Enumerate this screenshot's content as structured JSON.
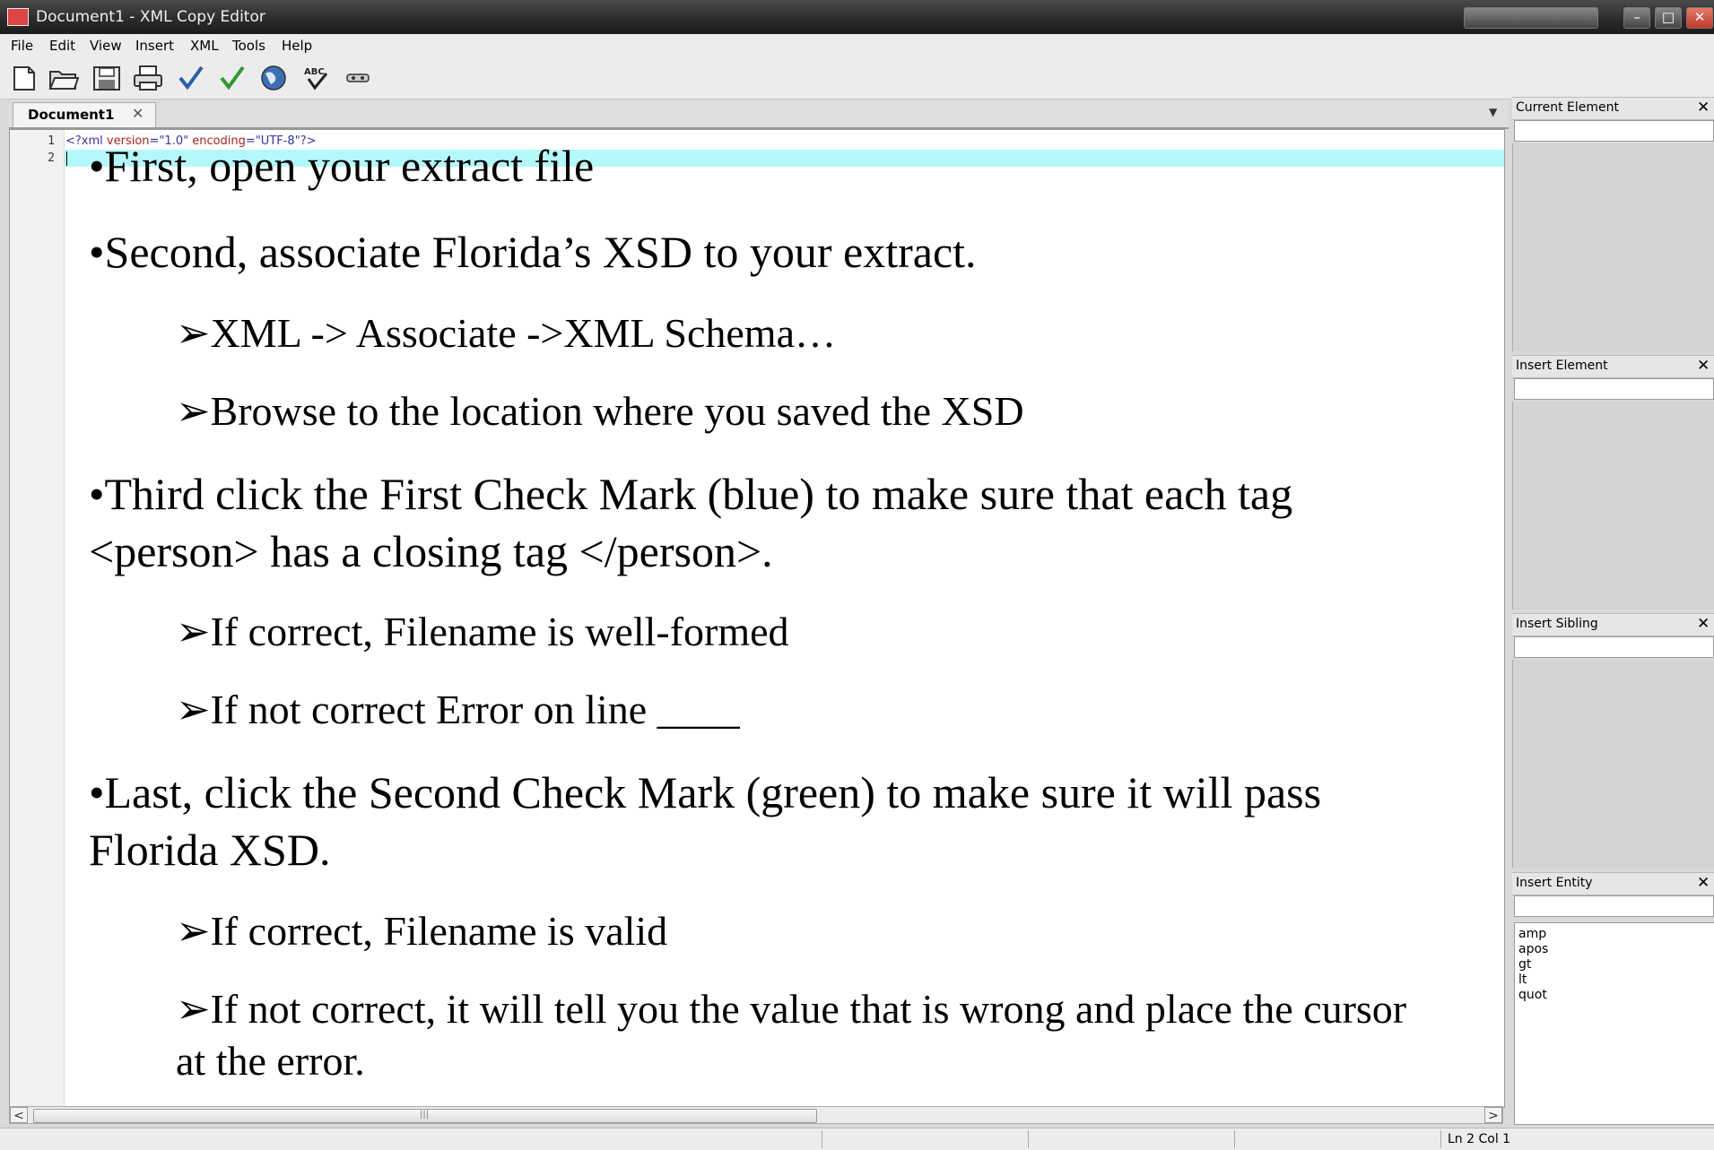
{
  "window": {
    "title": "Document1 - XML Copy Editor"
  },
  "menu": [
    "File",
    "Edit",
    "View",
    "Insert",
    "XML",
    "Tools",
    "Help"
  ],
  "toolbar": {
    "buttons": [
      "new-document",
      "open-folder",
      "save",
      "print",
      "check-well-formed",
      "validate",
      "browser",
      "spell-check",
      "tag-mode"
    ]
  },
  "tab": {
    "label": "Document1"
  },
  "editor": {
    "line_numbers": [
      "1",
      "2"
    ],
    "xml_declaration": {
      "open": "<?xml",
      "version_attr": "version",
      "version_value": "\"1.0\"",
      "encoding_attr": "encoding",
      "encoding_value": "\"UTF-8\"",
      "close": "?>"
    },
    "content": {
      "b1": "•First, open your extract file",
      "b2": "•Second, associate Florida’s XSD to your extract.",
      "b2_s1": "➢XML -> Associate ->XML Schema…",
      "b2_s2": "➢Browse to the location where you saved the XSD",
      "b3_l1": "•Third click the First Check Mark (blue) to make sure that each tag",
      "b3_l2": "<person> has a closing tag </person>.",
      "b3_s1": "➢If correct, Filename is well-formed",
      "b3_s2": "➢If not correct Error on line ____",
      "b4_l1": "•Last, click the Second Check Mark (green) to make sure it will pass",
      "b4_l2": "Florida XSD.",
      "b4_s1": "➢If correct, Filename is valid",
      "b4_s2_l1": "➢If not correct, it will tell you the value that is wrong and place the cursor",
      "b4_s2_l2": "at the error."
    },
    "hscroll_grip": "|||"
  },
  "panels": {
    "current_element": {
      "title": "Current Element"
    },
    "insert_element": {
      "title": "Insert Element"
    },
    "insert_sibling": {
      "title": "Insert Sibling"
    },
    "insert_entity": {
      "title": "Insert Entity",
      "items": [
        "amp",
        "apos",
        "gt",
        "lt",
        "quot"
      ]
    }
  },
  "status": {
    "position": "Ln 2 Col 1"
  },
  "colors": {
    "current_line_highlight": "#b4f9f9",
    "check_blue": "#2a5db0",
    "check_green": "#2e9a2e"
  }
}
